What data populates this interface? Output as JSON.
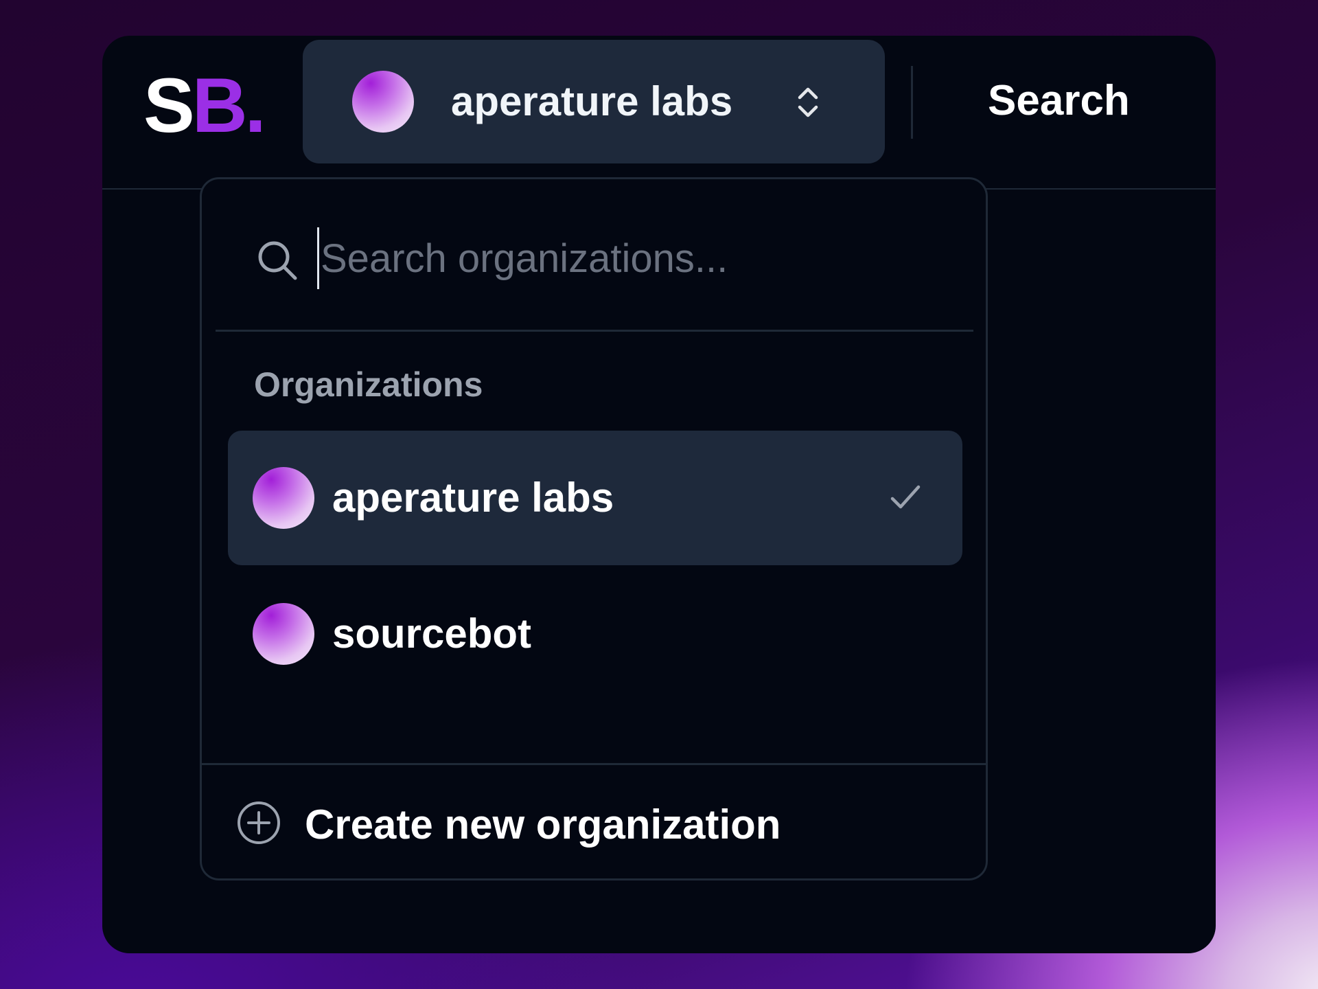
{
  "logo": {
    "first": "S",
    "second": "B."
  },
  "header": {
    "current_org": "aperature labs",
    "search_link": "Search"
  },
  "dropdown": {
    "search_placeholder": "Search organizations...",
    "group_heading": "Organizations",
    "organizations": [
      {
        "name": "aperature labs",
        "selected": true
      },
      {
        "name": "sourcebot",
        "selected": false
      }
    ],
    "create_label": "Create new organization"
  },
  "icons": {
    "switcher": "chevrons-up-down-icon",
    "search": "search-icon",
    "selected": "check-icon",
    "create": "plus-circle-icon"
  },
  "colors": {
    "accent": "#9b2fe6",
    "panel": "#030712",
    "selected_row": "#1e293b",
    "border": "#1f2937",
    "muted_text": "#9ca3af"
  }
}
